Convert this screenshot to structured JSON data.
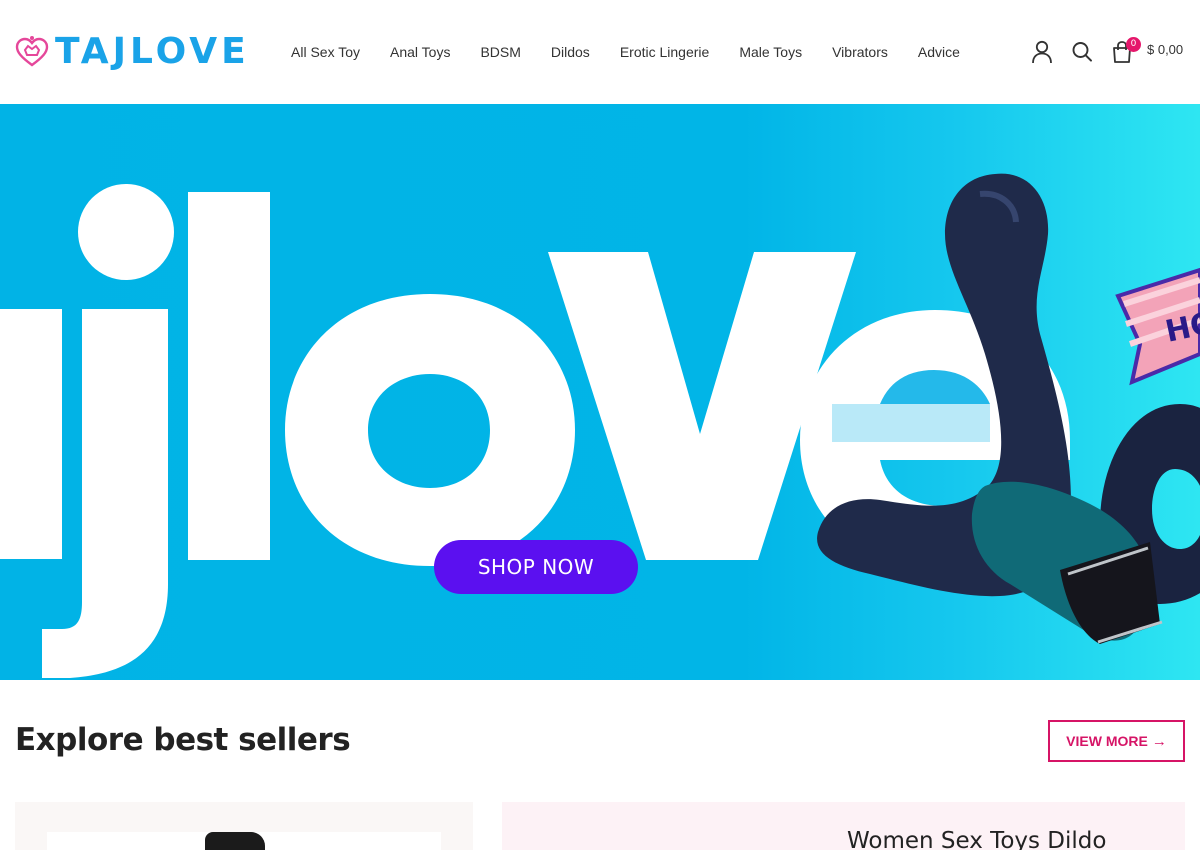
{
  "brand": {
    "name": "TAJLOVE",
    "accent": "#1aa3e8",
    "logo_icon": "heart-crown-icon"
  },
  "nav": {
    "items": [
      {
        "label": "All Sex Toy"
      },
      {
        "label": "Anal Toys"
      },
      {
        "label": "BDSM"
      },
      {
        "label": "Dildos"
      },
      {
        "label": "Erotic Lingerie"
      },
      {
        "label": "Male Toys"
      },
      {
        "label": "Vibrators"
      },
      {
        "label": "Advice"
      }
    ]
  },
  "header_actions": {
    "account_icon": "user-icon",
    "search_icon": "search-icon",
    "cart_icon": "shopping-bag-icon",
    "cart_count": "0",
    "cart_total": "$ 0,00"
  },
  "hero": {
    "wordmark": "ajlove",
    "ribbon_text": "HO",
    "cta_label": "SHOP NOW",
    "cta_color": "#5b10f0",
    "bg_color": "#01b3e6"
  },
  "bestsellers": {
    "title": "Explore best sellers",
    "view_more_label": "VIEW MORE",
    "view_more_icon": "arrow-right-icon",
    "view_more_color": "#d61466",
    "card_right_title": "Women Sex Toys Dildo"
  }
}
